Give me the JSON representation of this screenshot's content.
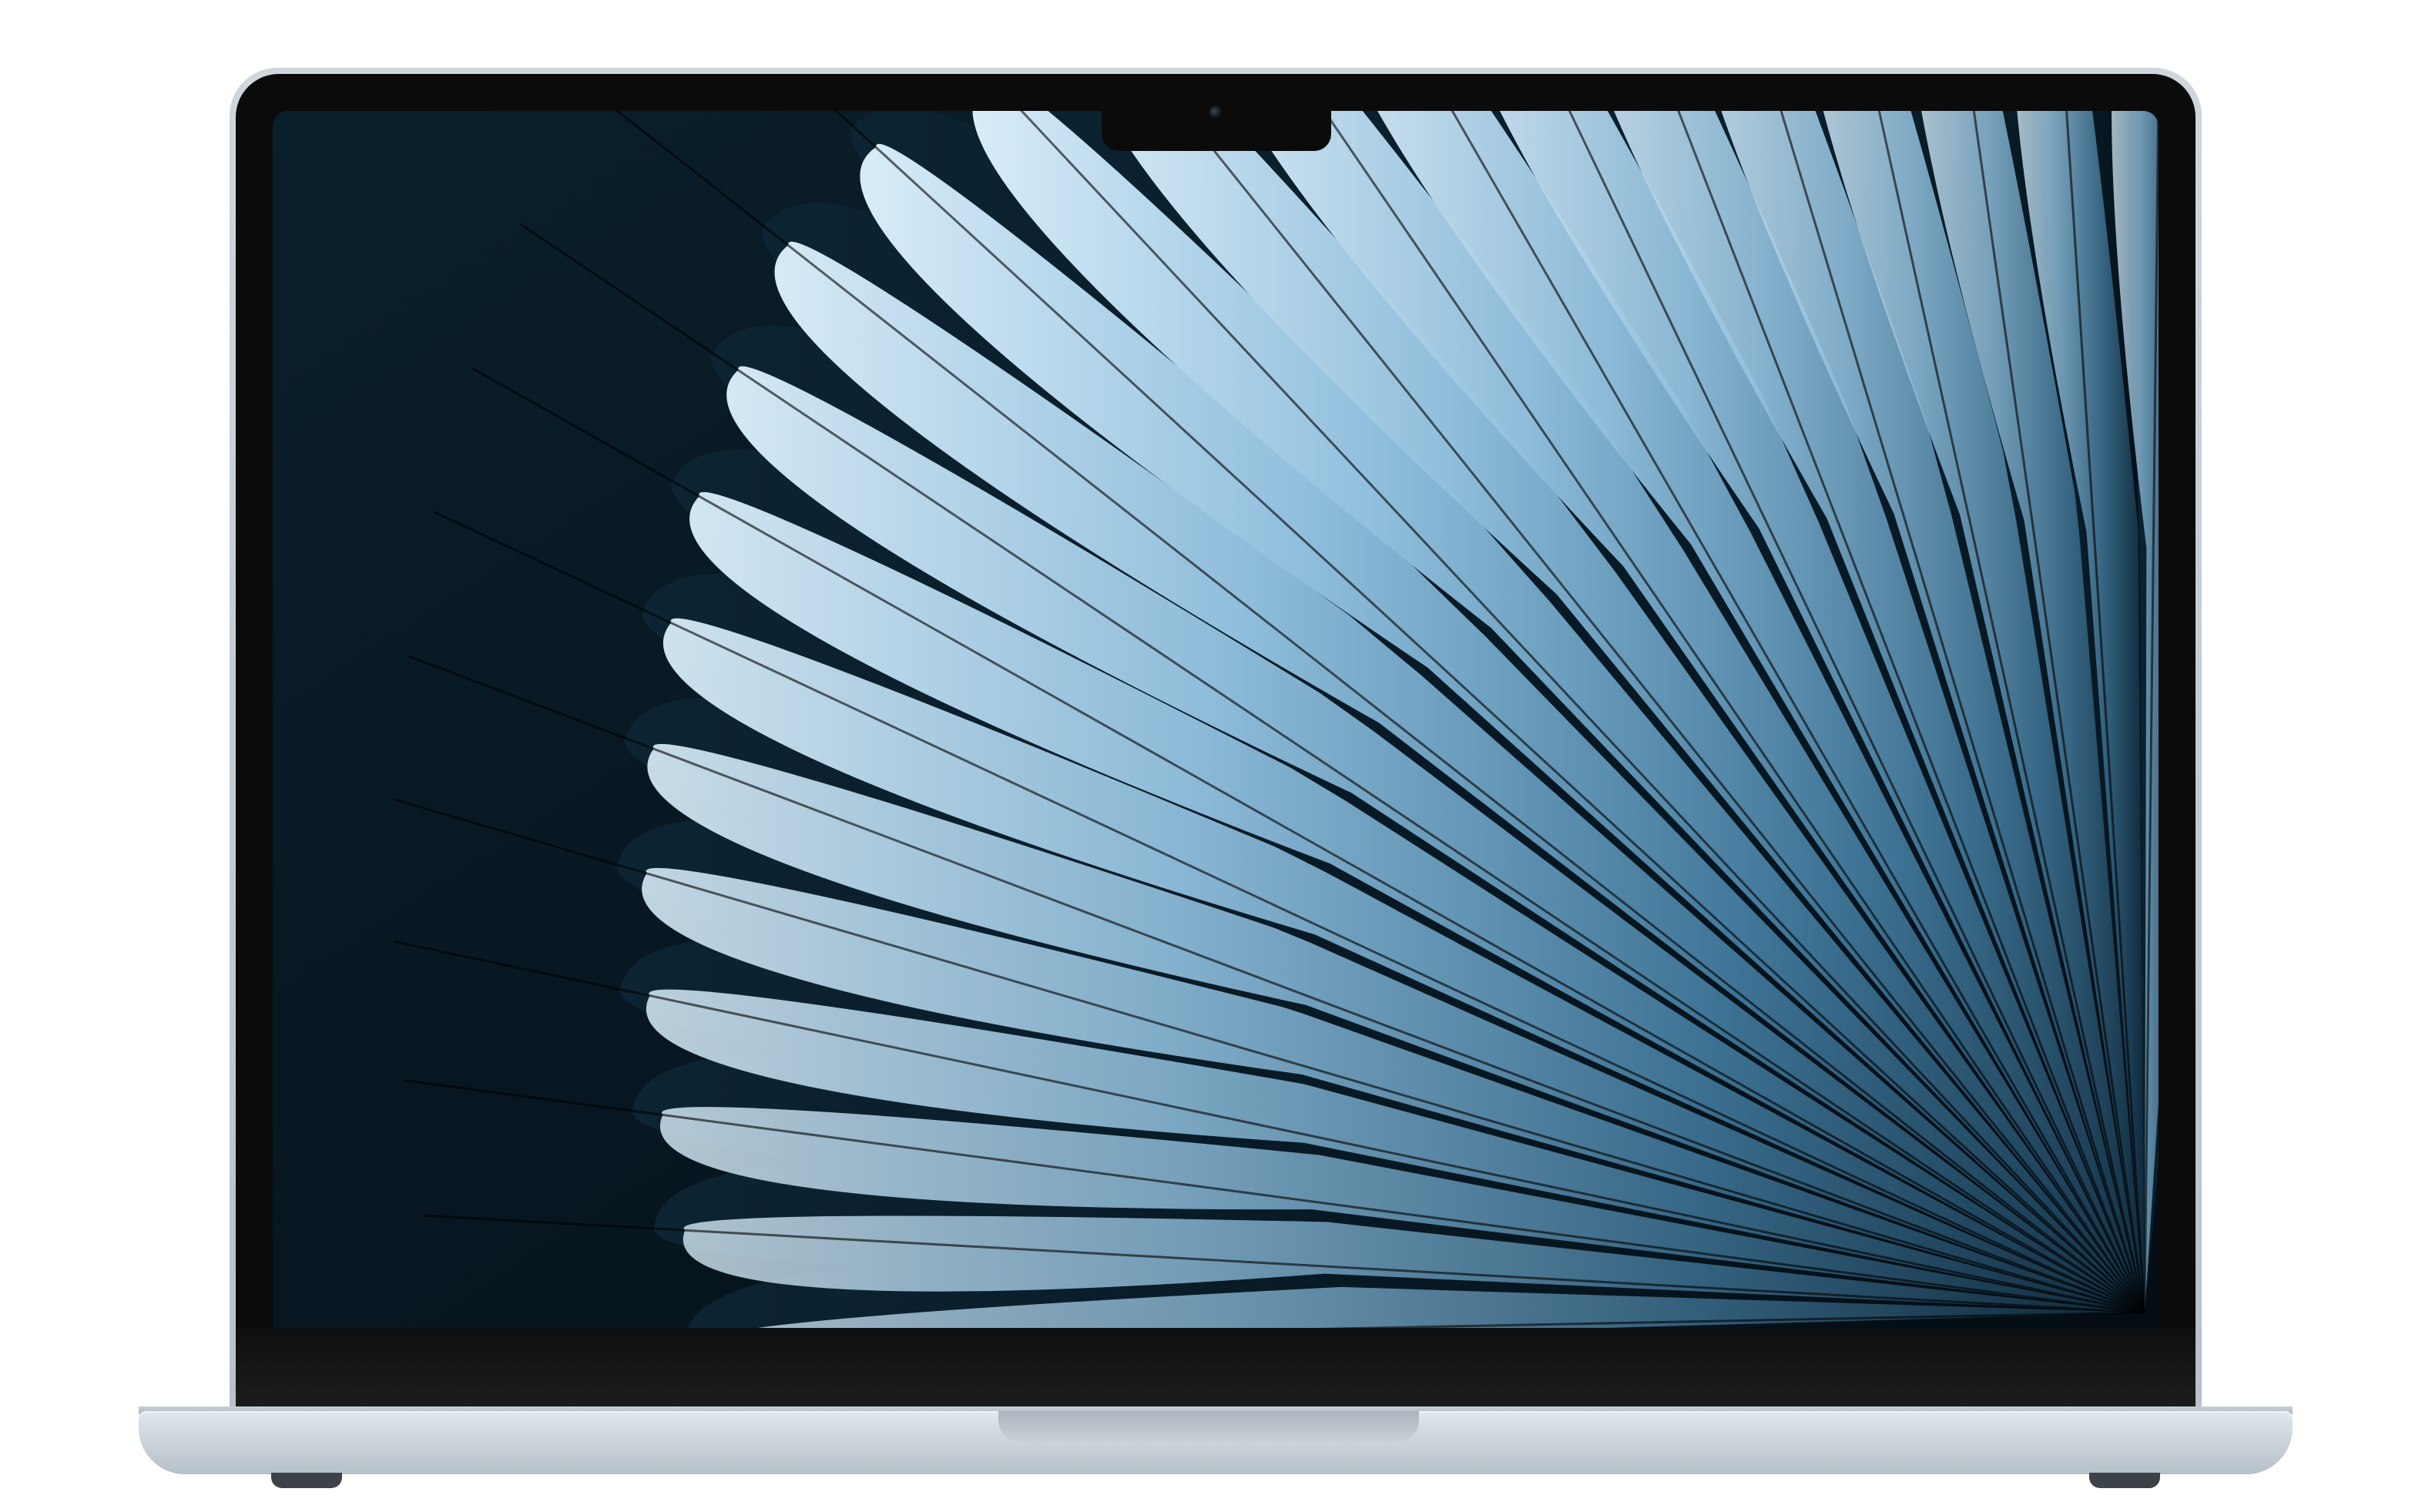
{
  "scene": {
    "subject": "laptop",
    "wallpaper": "blue-fan-wallpaper",
    "colors": {
      "background": "#ffffff",
      "body": "#c9d1d7",
      "bezel": "#0b0b0c",
      "wallpaper_light": "#cfe6f5",
      "wallpaper_mid": "#6e9ec0",
      "wallpaper_dark": "#06131c"
    }
  }
}
